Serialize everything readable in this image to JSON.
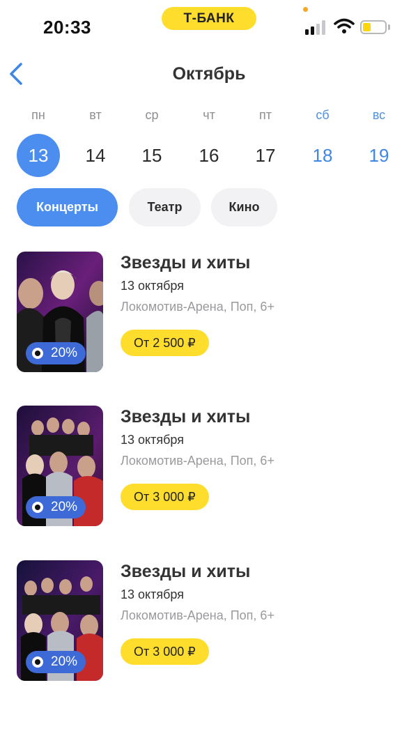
{
  "status_bar": {
    "time": "20:33",
    "brand": "Т-БАНК"
  },
  "header": {
    "title": "Октябрь"
  },
  "calendar": {
    "weekdays": [
      "пн",
      "вт",
      "ср",
      "чт",
      "пт",
      "сб",
      "вс"
    ],
    "days": [
      "13",
      "14",
      "15",
      "16",
      "17",
      "18",
      "19"
    ],
    "selected_day": "13"
  },
  "filters": [
    "Концерты",
    "Театр",
    "Кино"
  ],
  "active_filter": "Концерты",
  "colors": {
    "accent_blue": "#4b8ef0",
    "weekend_blue": "#3f87e5",
    "brand_yellow": "#ffdd2d",
    "discount_blue": "#3d6ad6",
    "chip_gray": "#f2f2f4"
  },
  "events": [
    {
      "title": "Звезды и хиты",
      "date": "13 октября",
      "venue": "Локомотив-Арена, Поп, 6+",
      "price": "От 2 500 ₽",
      "discount": "20%"
    },
    {
      "title": "Звезды и хиты",
      "date": "13 октября",
      "venue": "Локомотив-Арена, Поп, 6+",
      "price": "От 3 000 ₽",
      "discount": "20%"
    },
    {
      "title": "Звезды и хиты",
      "date": "13 октября",
      "venue": "Локомотив-Арена, Поп, 6+",
      "price": "От 3 000 ₽",
      "discount": "20%"
    }
  ]
}
